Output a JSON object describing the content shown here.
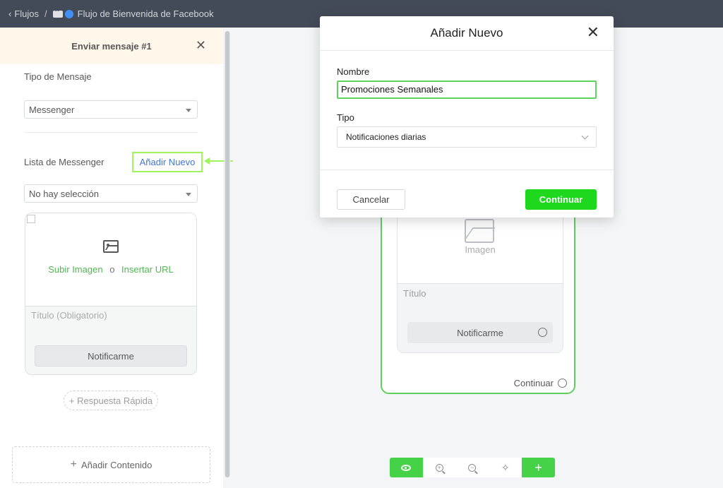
{
  "topbar": {
    "back_label": "Flujos",
    "separator": "/",
    "flow_name": "Flujo de Bienvenida de Facebook"
  },
  "panel": {
    "title": "Enviar mensaje #1",
    "message_type_label": "Tipo de Mensaje",
    "message_type_value": "Messenger",
    "list_label": "Lista de Messenger",
    "add_new_label": "Añadir Nuevo",
    "list_value": "No hay selección",
    "upload_image": "Subir Imagen",
    "or": "o",
    "insert_url": "Insertar URL",
    "title_placeholder": "Título (Obligatorio)",
    "notify_button": "Notificarme",
    "quick_reply": "+ Respuesta Rápida",
    "add_content": "Añadir Contenido"
  },
  "node": {
    "image_label": "Imagen",
    "title_label": "Título",
    "notify_button": "Notificarme",
    "continue_label": "Continuar"
  },
  "modal": {
    "title": "Añadir Nuevo",
    "name_label": "Nombre",
    "name_value": "Promociones Semanales",
    "type_label": "Tipo",
    "type_value": "Notificaciones diarias",
    "cancel": "Cancelar",
    "continue": "Continuar"
  },
  "colors": {
    "accent_green": "#1ed81e",
    "highlight_lime": "#8cf23a",
    "link_blue": "#1a56c7",
    "topbar_bg": "#1c2434"
  },
  "icons": [
    "chevron-left-icon",
    "messenger-chat-icon",
    "facebook-dot-icon",
    "close-icon",
    "image-icon",
    "eye-icon",
    "zoom-in-icon",
    "zoom-out-icon",
    "magic-icon",
    "plus-icon"
  ]
}
